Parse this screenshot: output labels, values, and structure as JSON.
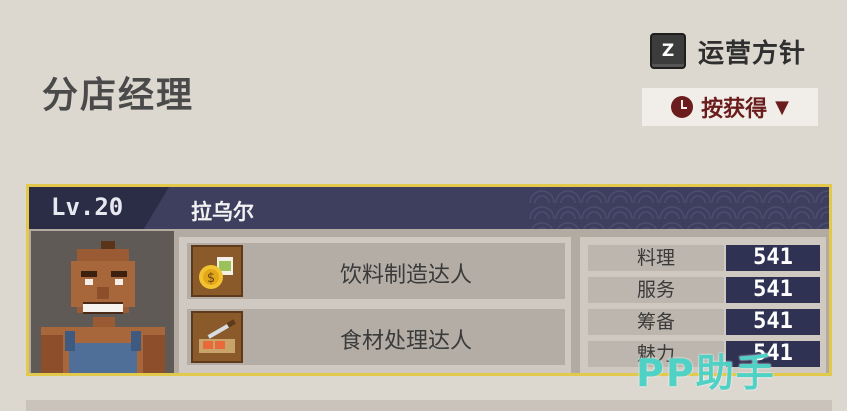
{
  "page": {
    "title": "分店经理"
  },
  "policy": {
    "key": "Z",
    "label": "运营方针"
  },
  "sort": {
    "label": "按获得",
    "arrow": "▼"
  },
  "manager": {
    "level": "Lv.20",
    "name": "拉乌尔",
    "skills": [
      {
        "label": "饮料制造达人",
        "icon": "drink-coin-icon"
      },
      {
        "label": "食材处理达人",
        "icon": "knife-board-icon"
      }
    ],
    "stats": [
      {
        "label": "料理",
        "value": "541"
      },
      {
        "label": "服务",
        "value": "541"
      },
      {
        "label": "筹备",
        "value": "541"
      },
      {
        "label": "魅力",
        "value": "541"
      }
    ]
  },
  "watermark": "PP助手",
  "colors": {
    "background": "#dcd7cf",
    "card_border": "#e2c94b",
    "header_navy": "#3e3f5e",
    "stat_value_bg": "#2f3253",
    "sort_accent": "#6b1d1d",
    "watermark": "#4fd1c5"
  }
}
